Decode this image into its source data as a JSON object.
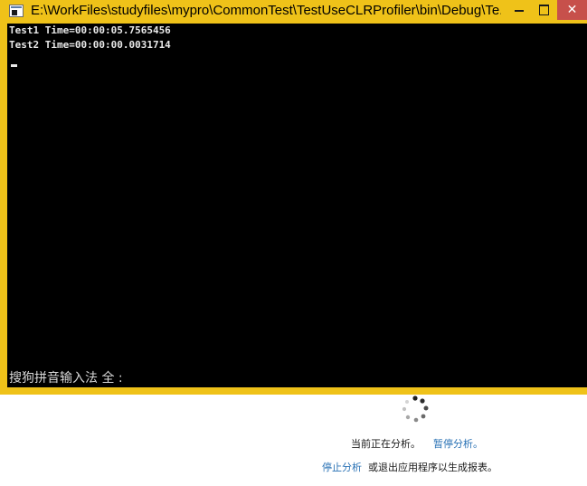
{
  "window": {
    "title": "E:\\WorkFiles\\studyfiles\\mypro\\CommonTest\\TestUseCLRProfiler\\bin\\Debug\\Te...",
    "close_glyph": "✕",
    "border_color": "#efc219",
    "close_color": "#c7504b"
  },
  "console": {
    "lines": [
      "Test1 Time=00:00:05.7565456",
      "Test2 Time=00:00:00.0031714"
    ],
    "ime_status": "搜狗拼音输入法 全 :"
  },
  "profiler": {
    "status": "当前正在分析。",
    "pause_link": "暂停分析。",
    "stop_link": "停止分析",
    "exit_text": "或退出应用程序以生成报表。",
    "link_color": "#2a72b5"
  }
}
